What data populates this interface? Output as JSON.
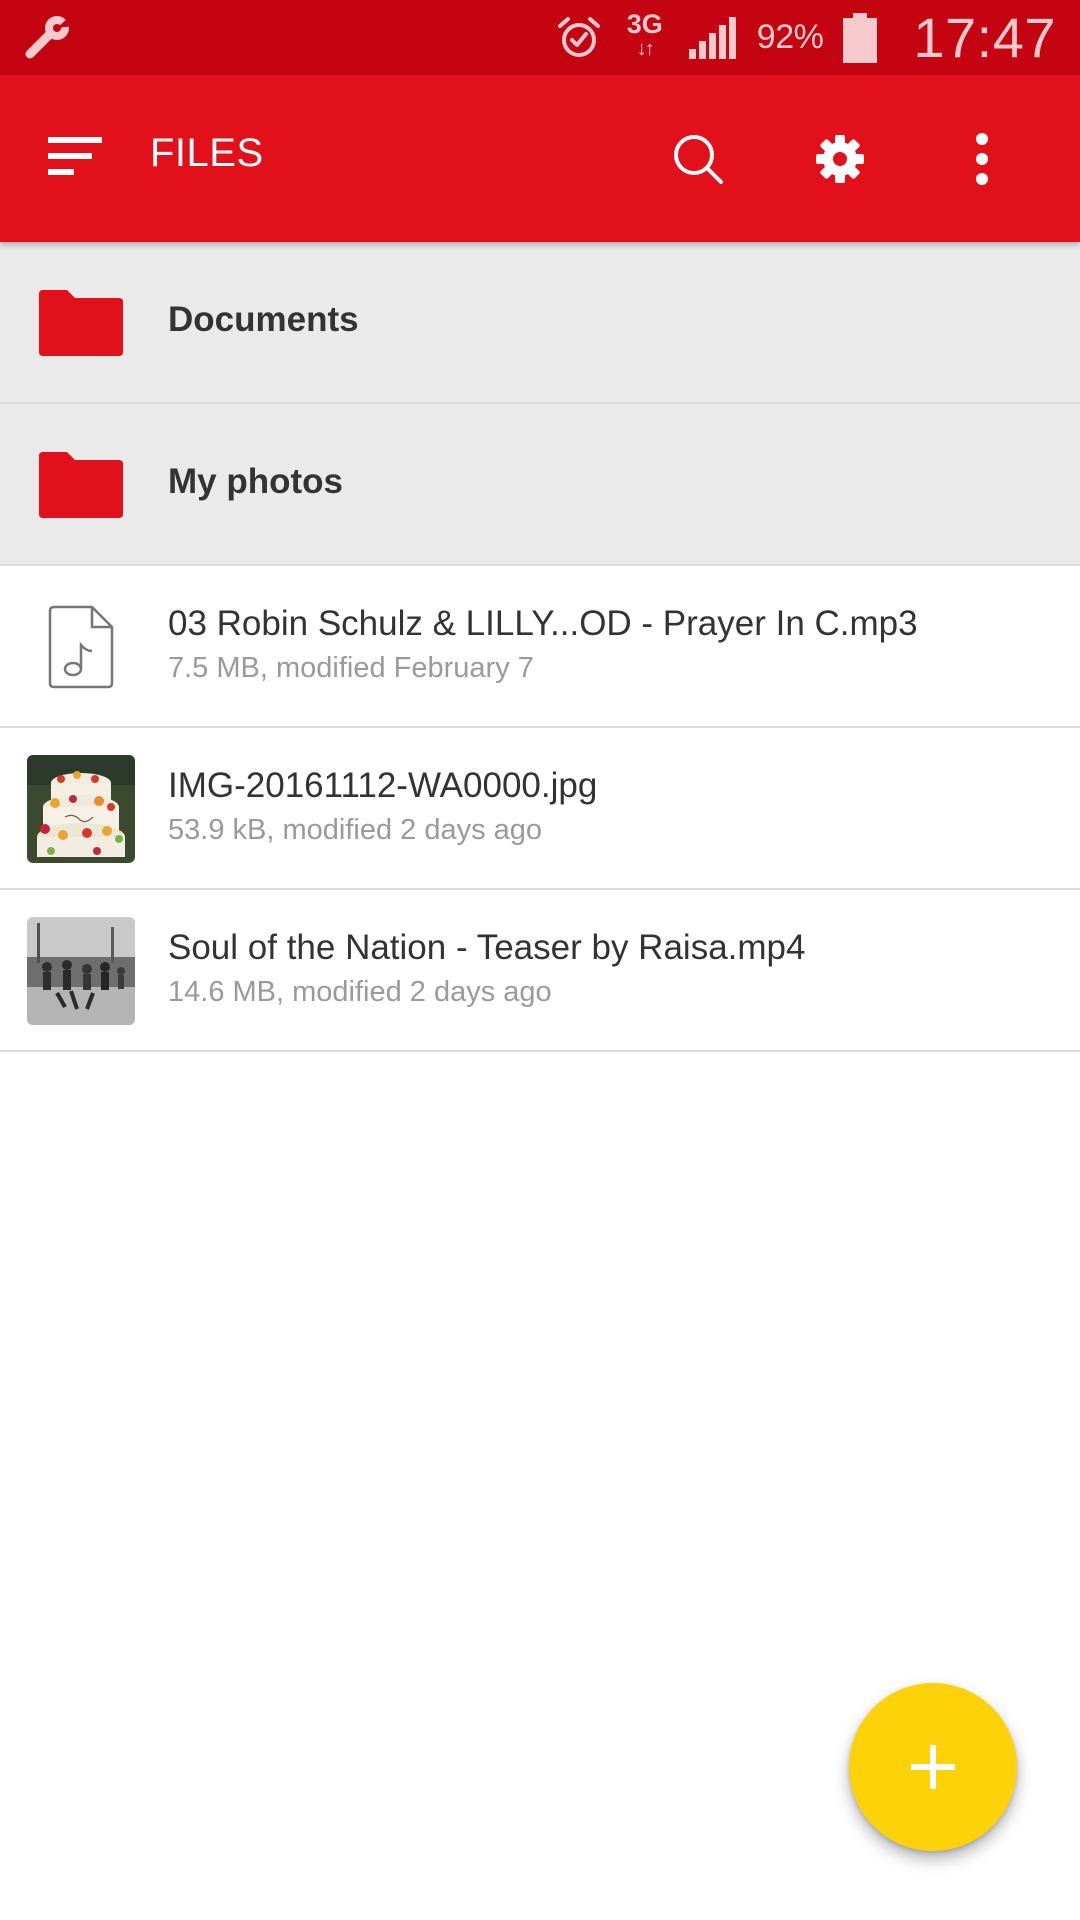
{
  "status_bar": {
    "network": "3G",
    "battery_percent": "92%",
    "battery_level": 0.92,
    "time": "17:47",
    "icons": [
      "wrench-icon",
      "alarm-icon",
      "network-arrows-icon",
      "signal-icon",
      "battery-icon"
    ]
  },
  "app_bar": {
    "title": "FILES",
    "icons": [
      "menu-icon",
      "search-icon",
      "gear-icon",
      "more-vert-icon"
    ]
  },
  "folders": [
    {
      "name": "Documents",
      "icon": "folder-icon"
    },
    {
      "name": "My photos",
      "icon": "folder-icon"
    }
  ],
  "files": [
    {
      "name": "03 Robin Schulz & LILLY...OD - Prayer In C.mp3",
      "meta": "7.5 MB, modified February 7",
      "icon": "audio-file-icon"
    },
    {
      "name": "IMG-20161112-WA0000.jpg",
      "meta": "53.9 kB, modified 2 days ago",
      "icon": "image-thumbnail"
    },
    {
      "name": "Soul of the Nation - Teaser by Raisa.mp4",
      "meta": "14.6 MB, modified 2 days ago",
      "icon": "video-thumbnail"
    }
  ],
  "fab": {
    "icon": "plus-icon"
  },
  "colors": {
    "status_bar": "#c40511",
    "app_bar": "#e2101a",
    "folder": "#e2101a",
    "fab": "#fdd208",
    "folder_row_bg": "#eaeaea"
  }
}
